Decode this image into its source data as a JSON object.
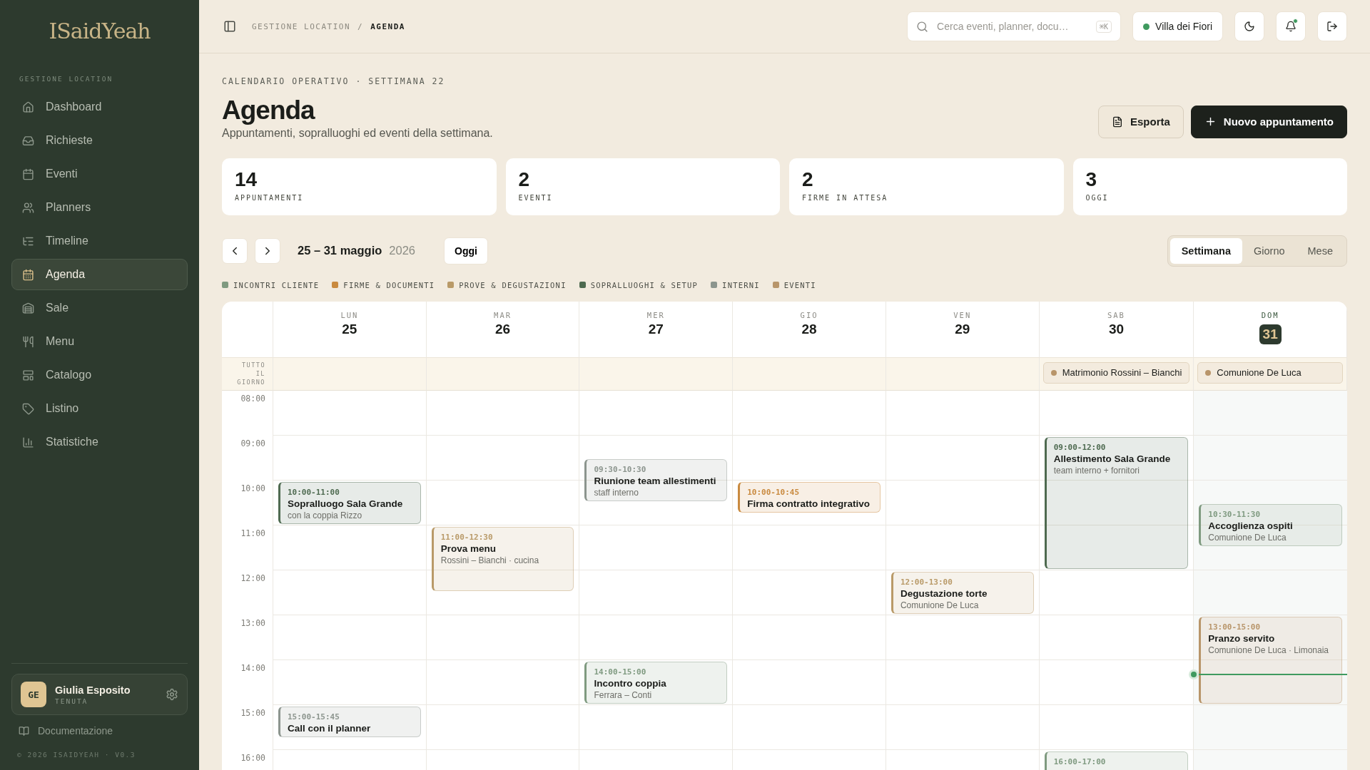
{
  "sidebar": {
    "logo": "ISaidYeah",
    "section": "GESTIONE LOCATION",
    "items": [
      {
        "label": "Dashboard",
        "selected": false
      },
      {
        "label": "Richieste",
        "selected": false
      },
      {
        "label": "Eventi",
        "selected": false
      },
      {
        "label": "Planners",
        "selected": false
      },
      {
        "label": "Timeline",
        "selected": false
      },
      {
        "label": "Agenda",
        "selected": true
      },
      {
        "label": "Sale",
        "selected": false
      },
      {
        "label": "Menu",
        "selected": false
      },
      {
        "label": "Catalogo",
        "selected": false
      },
      {
        "label": "Listino",
        "selected": false
      },
      {
        "label": "Statistiche",
        "selected": false
      }
    ],
    "user": {
      "initials": "GE",
      "name": "Giulia Esposito",
      "role": "TENUTA"
    },
    "docs": "Documentazione",
    "footer": "© 2026 ISAIDYEAH · V0.3"
  },
  "header": {
    "breadcrumb": [
      "GESTIONE LOCATION",
      "AGENDA"
    ],
    "separator": "/",
    "search": {
      "placeholder": "Cerca eventi, planner, docu…",
      "shortcut": "⌘K"
    },
    "venue": {
      "name": "Villa dei Fiori",
      "color": "#3f9a5f"
    },
    "notifications_unread": true
  },
  "page": {
    "eyebrow": "CALENDARIO OPERATIVO · SETTIMANA 22",
    "title": "Agenda",
    "subtitle": "Appuntamenti, sopralluoghi ed eventi della settimana.",
    "actions": [
      {
        "label": "Esporta",
        "kind": "secondary"
      },
      {
        "label": "Nuovo appuntamento",
        "kind": "primary"
      }
    ],
    "stats": [
      {
        "value": "14",
        "label": "APPUNTAMENTI"
      },
      {
        "value": "2",
        "label": "EVENTI"
      },
      {
        "value": "2",
        "label": "FIRME IN ATTESA"
      },
      {
        "value": "3",
        "label": "OGGI"
      }
    ],
    "range": "25 – 31 maggio",
    "year": "2026",
    "today_button": "Oggi",
    "views": [
      {
        "label": "Settimana",
        "selected": true
      },
      {
        "label": "Giorno",
        "selected": false
      },
      {
        "label": "Mese",
        "selected": false
      }
    ],
    "legend": [
      {
        "label": "INCONTRI CLIENTE",
        "color": "#7f9a80"
      },
      {
        "label": "FIRME & DOCUMENTI",
        "color": "#c98a3f"
      },
      {
        "label": "PROVE & DEGUSTAZIONI",
        "color": "#b99a68"
      },
      {
        "label": "SOPRALLUOGHI & SETUP",
        "color": "#4e6a50"
      },
      {
        "label": "INTERNI",
        "color": "#8c958e"
      },
      {
        "label": "EVENTI",
        "color": "#b8956a"
      }
    ]
  },
  "calendar": {
    "all_day_label": "TUTTO IL GIORNO",
    "hours": [
      "08:00",
      "09:00",
      "10:00",
      "11:00",
      "12:00",
      "13:00",
      "14:00",
      "15:00",
      "16:00"
    ],
    "days": [
      {
        "dow": "LUN",
        "day": "25",
        "today": false,
        "events": [
          {
            "time": "10:00-11:00",
            "title": "Sopralluogo Sala Grande",
            "subtitle": "con la coppia Rizzo",
            "color": "#4e6a50"
          },
          {
            "time": "15:00-15:45",
            "title": "Call con il planner",
            "color": "#8c958e"
          }
        ]
      },
      {
        "dow": "MAR",
        "day": "26",
        "today": false,
        "events": [
          {
            "time": "11:00-12:30",
            "title": "Prova menu",
            "subtitle": "Rossini – Bianchi · cucina",
            "color": "#b99a68"
          }
        ]
      },
      {
        "dow": "MER",
        "day": "27",
        "today": false,
        "events": [
          {
            "time": "09:30-10:30",
            "title": "Riunione team allestimenti",
            "subtitle": "staff interno",
            "color": "#8c958e"
          },
          {
            "time": "14:00-15:00",
            "title": "Incontro coppia",
            "subtitle": "Ferrara – Conti",
            "color": "#7f9a80"
          }
        ]
      },
      {
        "dow": "GIO",
        "day": "28",
        "today": false,
        "events": [
          {
            "time": "10:00-10:45",
            "title": "Firma contratto integrativo",
            "color": "#c98a3f"
          }
        ]
      },
      {
        "dow": "VEN",
        "day": "29",
        "today": false,
        "events": [
          {
            "time": "12:00-13:00",
            "title": "Degustazione torte",
            "subtitle": "Comunione De Luca",
            "color": "#b99a68"
          }
        ]
      },
      {
        "dow": "SAB",
        "day": "30",
        "today": false,
        "all_day": [
          {
            "title": "Matrimonio Rossini – Bianchi",
            "color": "#b8956a"
          }
        ],
        "events": [
          {
            "time": "09:00-12:00",
            "title": "Allestimento Sala Grande",
            "subtitle": "team interno + fornitori",
            "color": "#4e6a50"
          },
          {
            "time": "16:00-17:00",
            "color": "#7f9a80"
          }
        ]
      },
      {
        "dow": "DOM",
        "day": "31",
        "today": true,
        "all_day": [
          {
            "title": "Comunione De Luca",
            "color": "#b8956a"
          }
        ],
        "events": [
          {
            "time": "10:30-11:30",
            "title": "Accoglienza ospiti",
            "subtitle": "Comunione De Luca",
            "color": "#7f9a80"
          },
          {
            "time": "13:00-15:00",
            "title": "Pranzo servito",
            "subtitle": "Comunione De Luca · Limonaia",
            "color": "#b8956a"
          }
        ]
      }
    ]
  }
}
